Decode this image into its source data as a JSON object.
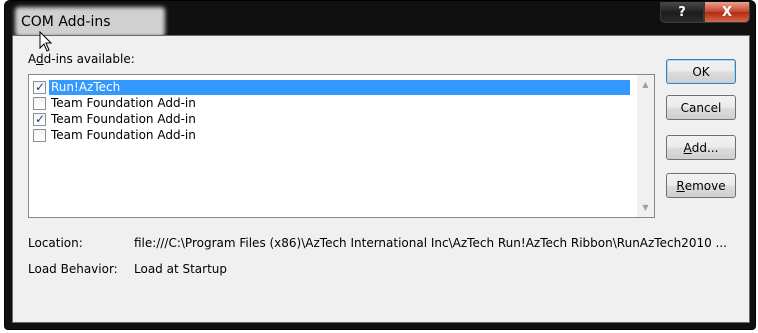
{
  "window": {
    "title": "COM Add-ins",
    "help_glyph": "?",
    "close_glyph": "X"
  },
  "addins": {
    "label_prefix": "A",
    "label_mnemonic": "d",
    "label_suffix": "d-ins available:",
    "items": [
      {
        "label": "Run!AzTech",
        "checked": true,
        "selected": true
      },
      {
        "label": "Team Foundation Add-in",
        "checked": false,
        "selected": false
      },
      {
        "label": "Team Foundation Add-in",
        "checked": true,
        "selected": false
      },
      {
        "label": "Team Foundation Add-in",
        "checked": false,
        "selected": false
      }
    ]
  },
  "buttons": {
    "ok": "OK",
    "cancel": "Cancel",
    "add_mnemonic": "A",
    "add_rest": "dd...",
    "remove_mnemonic": "R",
    "remove_rest": "emove"
  },
  "details": {
    "location_label": "Location:",
    "location_value": "file:///C:\\Program Files (x86)\\AzTech International Inc\\AzTech Run!AzTech Ribbon\\RunAzTech2010 ...",
    "load_behavior_label": "Load Behavior:",
    "load_behavior_value": "Load at Startup"
  },
  "colors": {
    "selection": "#3399ff",
    "close_button": "#c7432a",
    "frame": "#101010"
  }
}
